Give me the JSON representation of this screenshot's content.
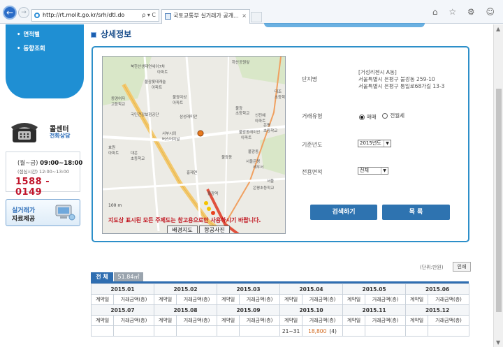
{
  "browser": {
    "address": "http://rt.molit.go.kr/srh/dtl.do",
    "address_tools": "ρ ▾ C",
    "tab_title": "국토교통부 실거래가 공개...",
    "tab_close": "×",
    "window_icons": "⌂ ☆ ⚙ ☺"
  },
  "sidebar": {
    "items": [
      {
        "label": "면적별"
      },
      {
        "label": "동향조회"
      }
    ],
    "callcenter": {
      "title": "콜센터",
      "subtitle": "전화상담"
    },
    "hours": {
      "weekday_label": "(월~금)",
      "weekday_time": "09:00~18:00",
      "lunch": "(점심시간) 12:00~13:00",
      "phone": "1588 - 0149"
    },
    "data_box": {
      "line1": "실거래가",
      "line2": "자료제공"
    }
  },
  "main": {
    "title": "상세정보",
    "map": {
      "notice": "지도상 표시된 모든 주제도는 참고용으로만 사용하시기 바랍니다.",
      "scale": "100 m",
      "btn_base": "배경지도",
      "btn_air": "항공사진",
      "labels": [
        "북한산생태연세이7차",
        "아파트",
        "불광롯데캐슬",
        "아파트",
        "동명여자",
        "고등학교",
        "불광미성",
        "아파트",
        "국민건강보험공단",
        "삼성래미안",
        "불광",
        "초등학교",
        "서부시외",
        "버스터미널",
        "대조",
        "초등학교",
        "은평",
        "초등학교",
        "불광동",
        "서울은평",
        "세무서",
        "하산공원앞",
        "효원",
        "아파트",
        "대은",
        "초등학교",
        "홍제연",
        "신진예",
        "아파트",
        "불광동",
        "불광동래미안",
        "아파트",
        "서울",
        "은평초등학교",
        "불광역"
      ]
    },
    "form": {
      "complex_label": "단지명",
      "complex_name": "[거성리첸시 A동]",
      "addr1": "서울특별시 은평구 불광동 259-10",
      "addr2": "서울특별시 은평구 통일로68가길 13-3",
      "trade_label": "거래유형",
      "trade_opts": [
        "매매",
        "전월세"
      ],
      "year_label": "기준년도",
      "year_value": "2015년도",
      "area_label": "전용면적",
      "area_value": "전체",
      "search_btn": "검색하기",
      "list_btn": "목 록"
    },
    "results": {
      "unit_note": "(단위:만원)",
      "print_btn": "인쇄",
      "tabs": [
        "전 체",
        "51.84㎡"
      ],
      "months_row1": [
        "2015.01",
        "2015.02",
        "2015.03",
        "2015.04",
        "2015.05",
        "2015.06"
      ],
      "months_row2": [
        "2015.07",
        "2015.08",
        "2015.09",
        "2015.10",
        "2015.11",
        "2015.12"
      ],
      "sub_headers": [
        "계약일",
        "거래금액(층)"
      ],
      "data_row": {
        "month_index": 3,
        "date": "21~31",
        "price": "18,800",
        "floor": "(4)"
      }
    }
  },
  "colors": {
    "accent": "#1f8fd3",
    "panel_border": "#2d8fc9",
    "button": "#2e73b0",
    "phone": "#c1152b"
  }
}
